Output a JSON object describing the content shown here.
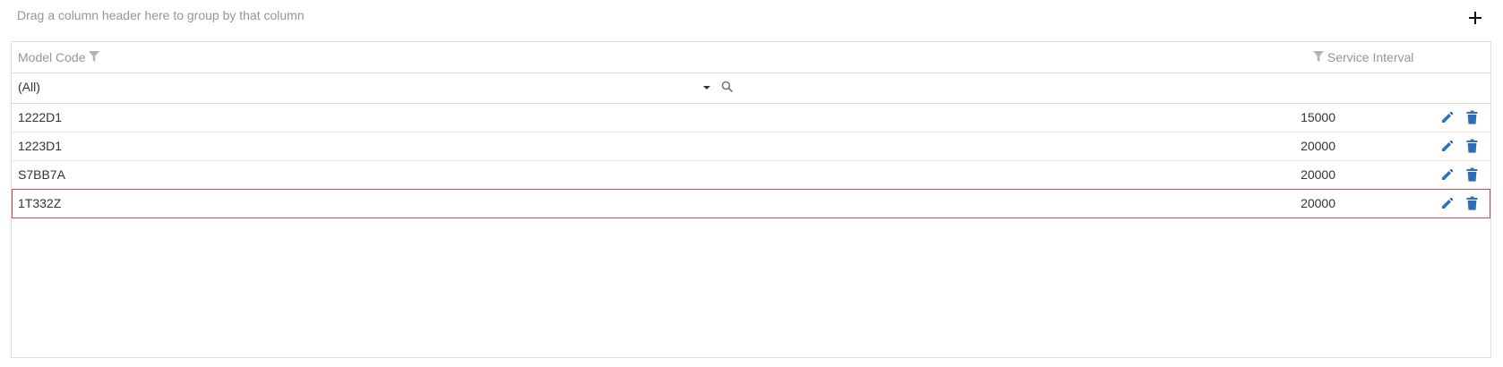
{
  "toolbar": {
    "group_hint": "Drag a column header here to group by that column",
    "add_icon": "plus-icon"
  },
  "grid": {
    "columns": [
      {
        "label": "Model Code",
        "icon": "filter-icon"
      },
      {
        "label": "Service Interval",
        "icon": "filter-icon"
      }
    ],
    "filter": {
      "model_code_value": "(All)",
      "search_icon": "search-icon"
    },
    "rows": [
      {
        "model_code": "1222D1",
        "service_interval": "15000",
        "selected": false
      },
      {
        "model_code": "1223D1",
        "service_interval": "20000",
        "selected": false
      },
      {
        "model_code": "S7BB7A",
        "service_interval": "20000",
        "selected": false
      },
      {
        "model_code": "1T332Z",
        "service_interval": "20000",
        "selected": true
      }
    ],
    "row_actions": [
      "edit-icon",
      "delete-icon"
    ]
  },
  "colors": {
    "action_blue": "#2c6fb7",
    "selected_border": "#e0444a",
    "header_text": "#959595"
  }
}
